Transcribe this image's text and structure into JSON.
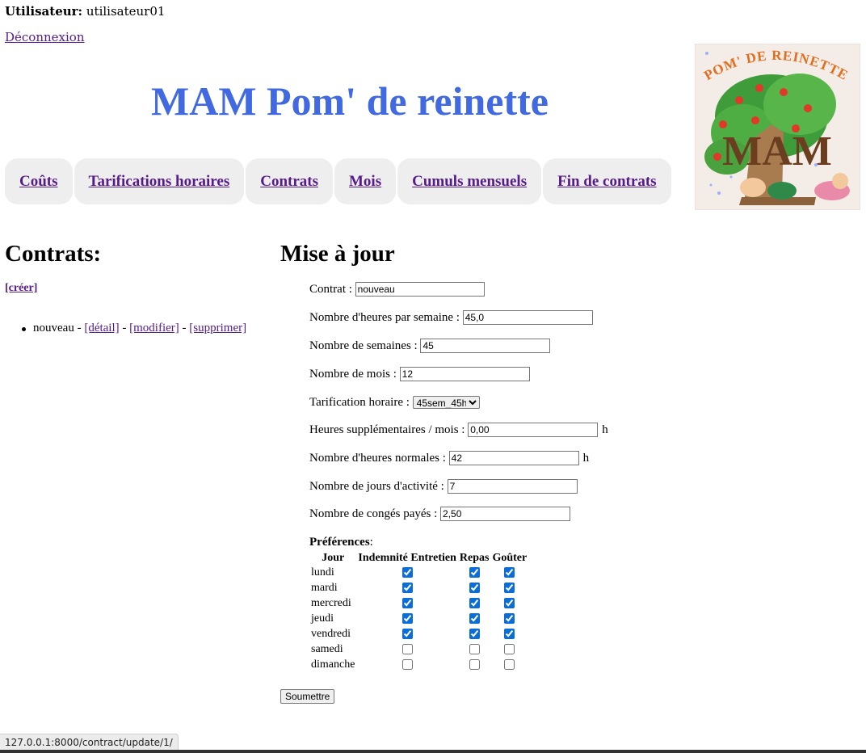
{
  "header": {
    "user_label": "Utilisateur:",
    "user_name": "utilisateur01",
    "logout_label": "Déconnexion",
    "site_title": "MAM Pom' de reinette",
    "title_color": "#4169e1",
    "logo_text": "POM' DE REINETTE",
    "logo_monogram": "MAM"
  },
  "nav": {
    "items": [
      {
        "label": "Coûts"
      },
      {
        "label": "Tarifications horaires"
      },
      {
        "label": "Contrats"
      },
      {
        "label": "Mois"
      },
      {
        "label": "Cumuls mensuels"
      },
      {
        "label": "Fin de contrats"
      }
    ]
  },
  "contracts": {
    "title": "Contrats:",
    "create_label": "[créer]",
    "items": [
      {
        "name": "nouveau",
        "sep1": " - ",
        "detail_label": "[détail]",
        "sep2": " - ",
        "modify_label": "[modifier]",
        "sep3": " - ",
        "delete_label": "[supprimer]"
      }
    ]
  },
  "form": {
    "title": "Mise à jour",
    "fields": {
      "contract": {
        "label": "Contrat : ",
        "value": "nouveau"
      },
      "hours_per_week": {
        "label": "Nombre d'heures par semaine : ",
        "value": "45,0"
      },
      "weeks": {
        "label": "Nombre de semaines : ",
        "value": "45"
      },
      "months": {
        "label": "Nombre de mois : ",
        "value": "12"
      },
      "hourly_rate": {
        "label": "Tarification horaire : ",
        "value": "45sem_45h"
      },
      "extra_hours": {
        "label": "Heures supplémentaires / mois : ",
        "value": "0,00",
        "unit": "h"
      },
      "normal_hours": {
        "label": "Nombre d'heures normales : ",
        "value": "42",
        "unit": "h"
      },
      "activity_days": {
        "label": "Nombre de jours d'activité : ",
        "value": "7"
      },
      "paid_leave": {
        "label": "Nombre de congés payés : ",
        "value": "2,50"
      }
    },
    "preferences": {
      "label": "Préférences",
      "label_suffix": ":",
      "columns": [
        "Jour",
        "Indemnité Entretien",
        "Repas",
        "Goûter"
      ],
      "rows": [
        {
          "day": "lundi",
          "indemnite": true,
          "repas": true,
          "gouter": true
        },
        {
          "day": "mardi",
          "indemnite": true,
          "repas": true,
          "gouter": true
        },
        {
          "day": "mercredi",
          "indemnite": true,
          "repas": true,
          "gouter": true
        },
        {
          "day": "jeudi",
          "indemnite": true,
          "repas": true,
          "gouter": true
        },
        {
          "day": "vendredi",
          "indemnite": true,
          "repas": true,
          "gouter": true
        },
        {
          "day": "samedi",
          "indemnite": false,
          "repas": false,
          "gouter": false
        },
        {
          "day": "dimanche",
          "indemnite": false,
          "repas": false,
          "gouter": false
        }
      ]
    },
    "submit_label": "Soumettre"
  },
  "status_bar": {
    "url": "127.0.0.1:8000/contract/update/1/"
  }
}
